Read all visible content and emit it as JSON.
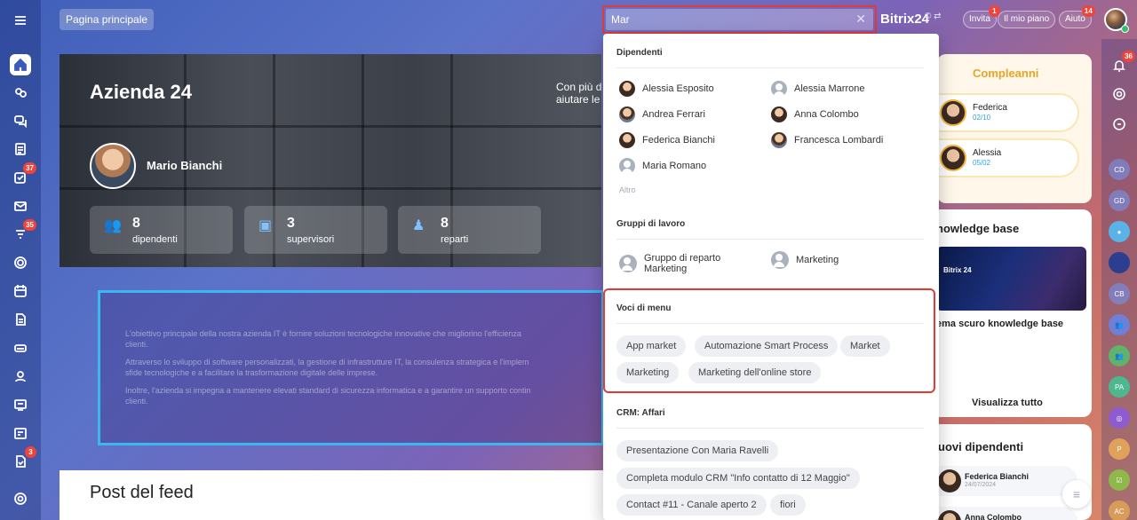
{
  "header": {
    "home_label": "Pagina principale",
    "search_value": "Mar",
    "brand": "Bitrix24",
    "brand_suffix": "© ⇄",
    "invite_label": "Invita",
    "invite_badge": "1",
    "plan_label": "Il mio piano",
    "help_label": "Aiuto",
    "help_badge": "14"
  },
  "left_rail": {
    "tasks_badge": "37",
    "feed_badge": "35",
    "automation_badge": "3"
  },
  "right_rail": {
    "notifications_badge": "36",
    "avatars": [
      "CD",
      "GD",
      "CB",
      "PA",
      "P",
      "AC"
    ]
  },
  "company": {
    "title": "Azienda 24",
    "blurb_line1": "Con più d",
    "blurb_line2": "aiutare le",
    "ceo_name": "Mario Bianchi",
    "stats": [
      {
        "value": "8",
        "label": "dipendenti"
      },
      {
        "value": "3",
        "label": "supervisori"
      },
      {
        "value": "8",
        "label": "reparti"
      }
    ]
  },
  "mission": {
    "p1": "L'obiettivo principale della nostra azienda IT è fornire soluzioni tecnologiche innovative che migliorino l'efficienza",
    "p1b": "clienti.",
    "p2": "Attraverso lo sviluppo di software personalizzati, la gestione di infrastrutture IT, la consulenza strategica e l'implem",
    "p2b": "sfide tecnologiche e a facilitare la trasformazione digitale delle imprese.",
    "p3": "Inoltre, l'azienda si impegna a mantenere elevati standard di sicurezza informatica e a garantire un supporto contin",
    "p3b": "clienti."
  },
  "feed": {
    "title": "Post del feed"
  },
  "birthdays": {
    "title": "Compleanni",
    "items": [
      {
        "name": "Federica",
        "date": "02/10"
      },
      {
        "name": "Alessia",
        "date": "05/02"
      }
    ]
  },
  "knowledge": {
    "title": "nowledge base",
    "card_label": "Bitrix 24",
    "item": "ema scuro knowledge base",
    "view_all": "Visualizza tutto"
  },
  "new_employees": {
    "title": "uovi dipendenti",
    "items": [
      {
        "name": "Federica Bianchi",
        "date": "24/07/2024"
      },
      {
        "name": "Anna Colombo",
        "date": ""
      }
    ]
  },
  "dropdown": {
    "employees_title": "Dipendenti",
    "employees": [
      "Alessia Esposito",
      "Alessia Marrone",
      "Andrea Ferrari",
      "Anna Colombo",
      "Federica Bianchi",
      "Francesca Lombardi",
      "Maria Romano"
    ],
    "more": "Altro",
    "groups_title": "Gruppi di lavoro",
    "group1_line1": "Gruppo di reparto",
    "group1_line2": "Marketing",
    "group2": "Marketing",
    "menu_title": "Voci di menu",
    "menu_items": [
      "App market",
      "Automazione Smart Process",
      "Market",
      "Marketing",
      "Marketing dell'online store"
    ],
    "crm_title": "CRM: Affari",
    "crm_items": [
      "Presentazione Con Maria Ravelli",
      "Completa modulo CRM \"Info contatto di 12 Maggio\"",
      "Contact #11 - Canale aperto 2",
      "fiori"
    ]
  }
}
